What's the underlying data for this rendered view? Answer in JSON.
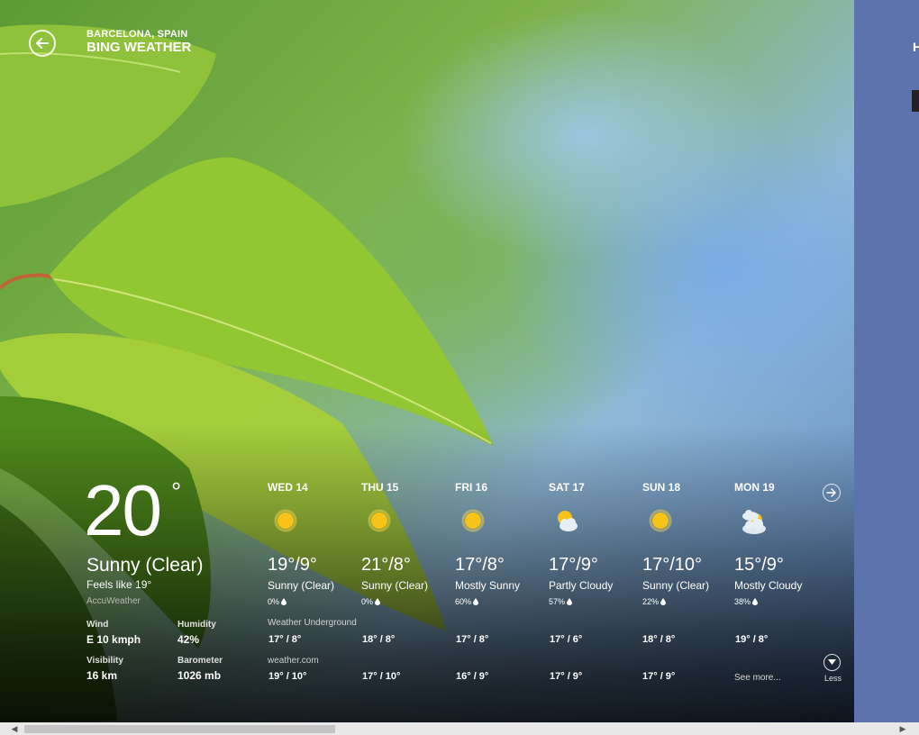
{
  "header": {
    "city": "BARCELONA, SPAIN",
    "app_title": "BING WEATHER",
    "side_letter": "H"
  },
  "current": {
    "temperature": "20",
    "degree": "°",
    "condition": "Sunny (Clear)",
    "feels_like": "Feels like 19°",
    "provider": "AccuWeather",
    "details": [
      {
        "label": "Wind",
        "value": "E 10 kmph"
      },
      {
        "label": "Humidity",
        "value": "42%"
      },
      {
        "label": "Visibility",
        "value": "16 km"
      },
      {
        "label": "Barometer",
        "value": "1026 mb"
      }
    ]
  },
  "forecast": [
    {
      "day": "WED 14",
      "temps": "19°/9°",
      "condition": "Sunny (Clear)",
      "precip": "0%",
      "icon": "sun-icon"
    },
    {
      "day": "THU 15",
      "temps": "21°/8°",
      "condition": "Sunny (Clear)",
      "precip": "0%",
      "icon": "sun-icon"
    },
    {
      "day": "FRI 16",
      "temps": "17°/8°",
      "condition": "Mostly Sunny",
      "precip": "60%",
      "icon": "sun-icon"
    },
    {
      "day": "SAT 17",
      "temps": "17°/9°",
      "condition": "Partly Cloudy",
      "precip": "57%",
      "icon": "partly-cloudy-icon"
    },
    {
      "day": "SUN 18",
      "temps": "17°/10°",
      "condition": "Sunny (Clear)",
      "precip": "22%",
      "icon": "sun-icon"
    },
    {
      "day": "MON 19",
      "temps": "15°/9°",
      "condition": "Mostly Cloudy",
      "precip": "38%",
      "icon": "mostly-cloudy-icon"
    }
  ],
  "sources": [
    {
      "name": "Weather Underground",
      "values": [
        "17° / 8°",
        "18° / 8°",
        "17° / 8°",
        "17° / 6°",
        "18° / 8°",
        "19° / 8°"
      ]
    },
    {
      "name": "weather.com",
      "values": [
        "19° / 10°",
        "17° / 10°",
        "16° / 9°",
        "17° / 9°",
        "17° / 9°"
      ],
      "see_more": "See more..."
    }
  ],
  "controls": {
    "less_label": "Less"
  },
  "colors": {
    "sun": "#f7c318",
    "cloud": "#e8eef5",
    "side_panel": "#5c73ad"
  }
}
